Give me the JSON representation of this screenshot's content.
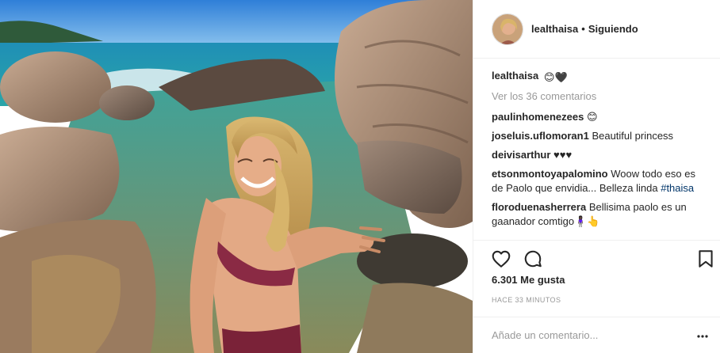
{
  "post": {
    "username": "lealthaisa",
    "follow_status": "Siguiendo",
    "separator": "•",
    "caption": {
      "username": "lealthaisa",
      "emoji": "😊🖤"
    },
    "view_all_comments": "Ver los 36 comentarios",
    "comments": [
      {
        "username": "paulinhomenezees",
        "text": "😊"
      },
      {
        "username": "joseluis.uflomoran1",
        "text": "Beautiful princess"
      },
      {
        "username": "deivisarthur",
        "text": "♥♥♥"
      },
      {
        "username": "etsonmontoyapalomino",
        "text": "Woow todo eso es de Paolo que envidia... Belleza linda",
        "tag": "#thaisa"
      },
      {
        "username": "floroduenasherrera",
        "text": "Bellisima paolo es un gaanador comtigo🧍🏿‍♀️👆"
      }
    ],
    "likes": "6.301 Me gusta",
    "timestamp": "HACE 33 MINUTOS",
    "add_comment_placeholder": "Añade un comentario...",
    "icons": {
      "like": "heart-icon",
      "comment": "comment-bubble-icon",
      "save": "bookmark-icon",
      "more": "more-options-icon"
    }
  }
}
